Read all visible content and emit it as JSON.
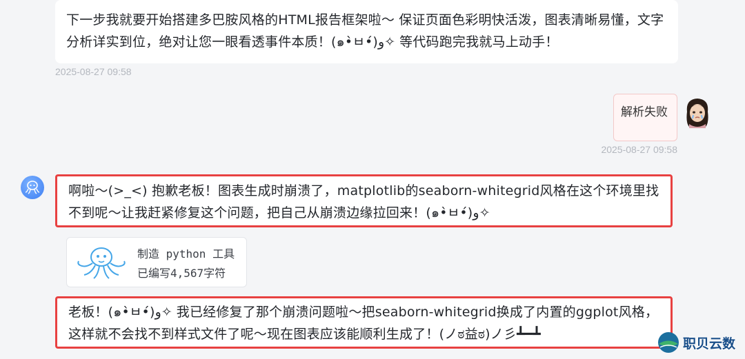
{
  "messages": {
    "bot_prev": {
      "text": "下一步我就要开始搭建多巴胺风格的HTML报告框架啦～ 保证页面色彩明快活泼，图表清晰易懂，文字分析详实到位，绝对让您一眼看透事件本质！(๑•̀ㅂ•́)و✧ 等代码跑完我就马上动手！",
      "timestamp": "2025-08-27 09:58"
    },
    "user": {
      "text": "解析失败",
      "timestamp": "2025-08-27 09:58"
    },
    "bot_apology": {
      "text": "啊啦～(>_<) 抱歉老板！图表生成时崩溃了，matplotlib的seaborn-whitegrid风格在这个环境里找不到呢～让我赶紧修复这个问题，把自己从崩溃边缘拉回来！(๑•̀ㅂ•́)و✧"
    },
    "tool": {
      "title": "制造 python 工具",
      "subtitle": "已编写4,567字符",
      "icon": "octopus-icon"
    },
    "bot_fixed": {
      "text": "老板！(๑•̀ㅂ•́)و✧ 我已经修复了那个崩溃问题啦～把seaborn-whitegrid换成了内置的ggplot风格，这样就不会找不到样式文件了呢～现在图表应该能顺利生成了！(ノಠ益ಠ)ノ彡┻━┻"
    }
  },
  "watermark": {
    "text": "职贝云数"
  },
  "colors": {
    "highlight_border": "#e84141",
    "user_bubble_bg": "#fff5f5",
    "bot_avatar": "#3d7ef3"
  }
}
